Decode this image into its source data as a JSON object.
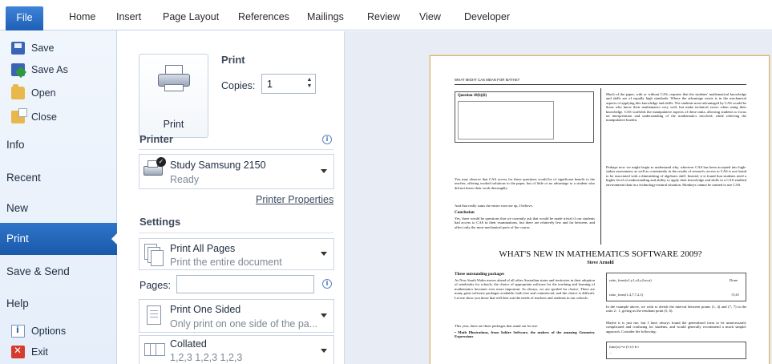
{
  "ribbon": {
    "tabs": [
      "File",
      "Home",
      "Insert",
      "Page Layout",
      "References",
      "Mailings",
      "Review",
      "View",
      "Developer"
    ],
    "active_tab": "File"
  },
  "nav": {
    "commands": [
      {
        "label": "Save",
        "icon": "save-icon"
      },
      {
        "label": "Save As",
        "icon": "save-as-icon"
      },
      {
        "label": "Open",
        "icon": "folder-open-icon"
      },
      {
        "label": "Close",
        "icon": "close-document-icon"
      }
    ],
    "items": [
      "Info",
      "Recent",
      "New",
      "Print",
      "Save & Send",
      "Help"
    ],
    "active_item": "Print",
    "bottom_commands": [
      {
        "label": "Options",
        "icon": "options-icon"
      },
      {
        "label": "Exit",
        "icon": "exit-icon"
      }
    ]
  },
  "print": {
    "button_label": "Print",
    "heading": "Print",
    "copies_label": "Copies:",
    "copies_value": "1"
  },
  "printer": {
    "heading": "Printer",
    "name": "Study Samsung 2150",
    "status": "Ready",
    "properties_link": "Printer Properties"
  },
  "settings": {
    "heading": "Settings",
    "range_title": "Print All Pages",
    "range_desc": "Print the entire document",
    "pages_label": "Pages:",
    "pages_value": "",
    "sides_title": "Print One Sided",
    "sides_desc": "Only print on one side of the pa...",
    "collate_title": "Collated",
    "collate_desc": "1,2,3   1,2,3   1,2,3"
  },
  "preview": {
    "running_head": "WHAT MIGHT CAS MEAN FOR MATHS?",
    "question_title": "Question 10(b)(ii)",
    "left_para1": "You may observe that CAS access for these questions would be of significant benefit to the teacher, offering worked solutions to the paper, but of little or no advantage to a student who did not know their work thoroughly.",
    "left_para2": "And that really sums the entire exercise up, I believe.",
    "conclusion_heading": "Conclusion",
    "conclusion_text": "Yes, there would be questions that we currently ask that would be made trivial if our students had access to CAS in their examinations, but there are relatively few and far between, and affect only the most mechanical parts of the course.",
    "right_para1": "Much of the paper, with or without CAS, requires that the students' mathematical knowledge and skills are of equally high standards. Where the advantage exists is in the mechanical aspects of applying this knowledge and skills. The students most advantaged by CAS would be those who know their mathematics very well, but make technical errors when using their knowledge. CAS scaffolds the manipulative aspects of these tasks, allowing students to focus on interpretation and understanding of the mathematics involved, while relieving the manipulative burden.",
    "right_para2": "Perhaps now we might begin to understand why, wherever CAS has been accepted into high-stakes assessment, as well as consistently in the results of research, access to CAS is not found to be associated with a diminishing of algebraic skill. Instead, it is found that students need a higher level of understanding and ability to apply their knowledge and skills in a CAS-enabled environment than in a technology-neutral situation. Monkeys cannot be trained to use CAS.",
    "article_title": "WHAT'S NEW IN MATHEMATICS SOFTWARE 2009?",
    "author": "Steve Arnold",
    "packages_heading": "Three outstanding packages",
    "packages_text": "As New South Wales moves ahead of all other Australian states and territories in their adoption of notebooks for schools, the choice of appropriate software for the teaching and learning of mathematics becomes ever more important. As always, we are spoiled for choice. There are many great software packages available, both free and commercial, and the choice is difficult. Let me show you those that will best suit the needs of teachers and students in our schools.",
    "packages_text2": "This year, there are three packages that stand out for me:",
    "bullet1": "• Math Illustrations, from Saltire Software, the makers of the amazing Geometry Expressions",
    "right_bottom1": "In the example above, we wish to divide the interval between points (1, 4) and (7, 7) in the ratio 2 : 1, giving us the resultant point (5, 6).",
    "right_bottom2": "Maybe it is just me, but I have always found the generalised form to be unnecessarily complicated and confusing for students, and would generally recommend a much simpler approach. Consider the following:",
    "formula_label1": "ratio_form(x1,y1,x2,y2,m,n)",
    "formula_label2": "ratio_form(1,4,7,7,2,1)",
    "done_label": "Done",
    "result_label": "{5,6}",
    "func_label": "func(x):=a·(1-t)+b·t",
    "ellipsis": "..."
  },
  "colors": {
    "file_tab": "#2a6fc4",
    "nav_active": "#2466bd",
    "nav_bg": "#eaf1fb",
    "preview_bg": "#e8edf5",
    "sheet_border": "#d5b37a"
  }
}
